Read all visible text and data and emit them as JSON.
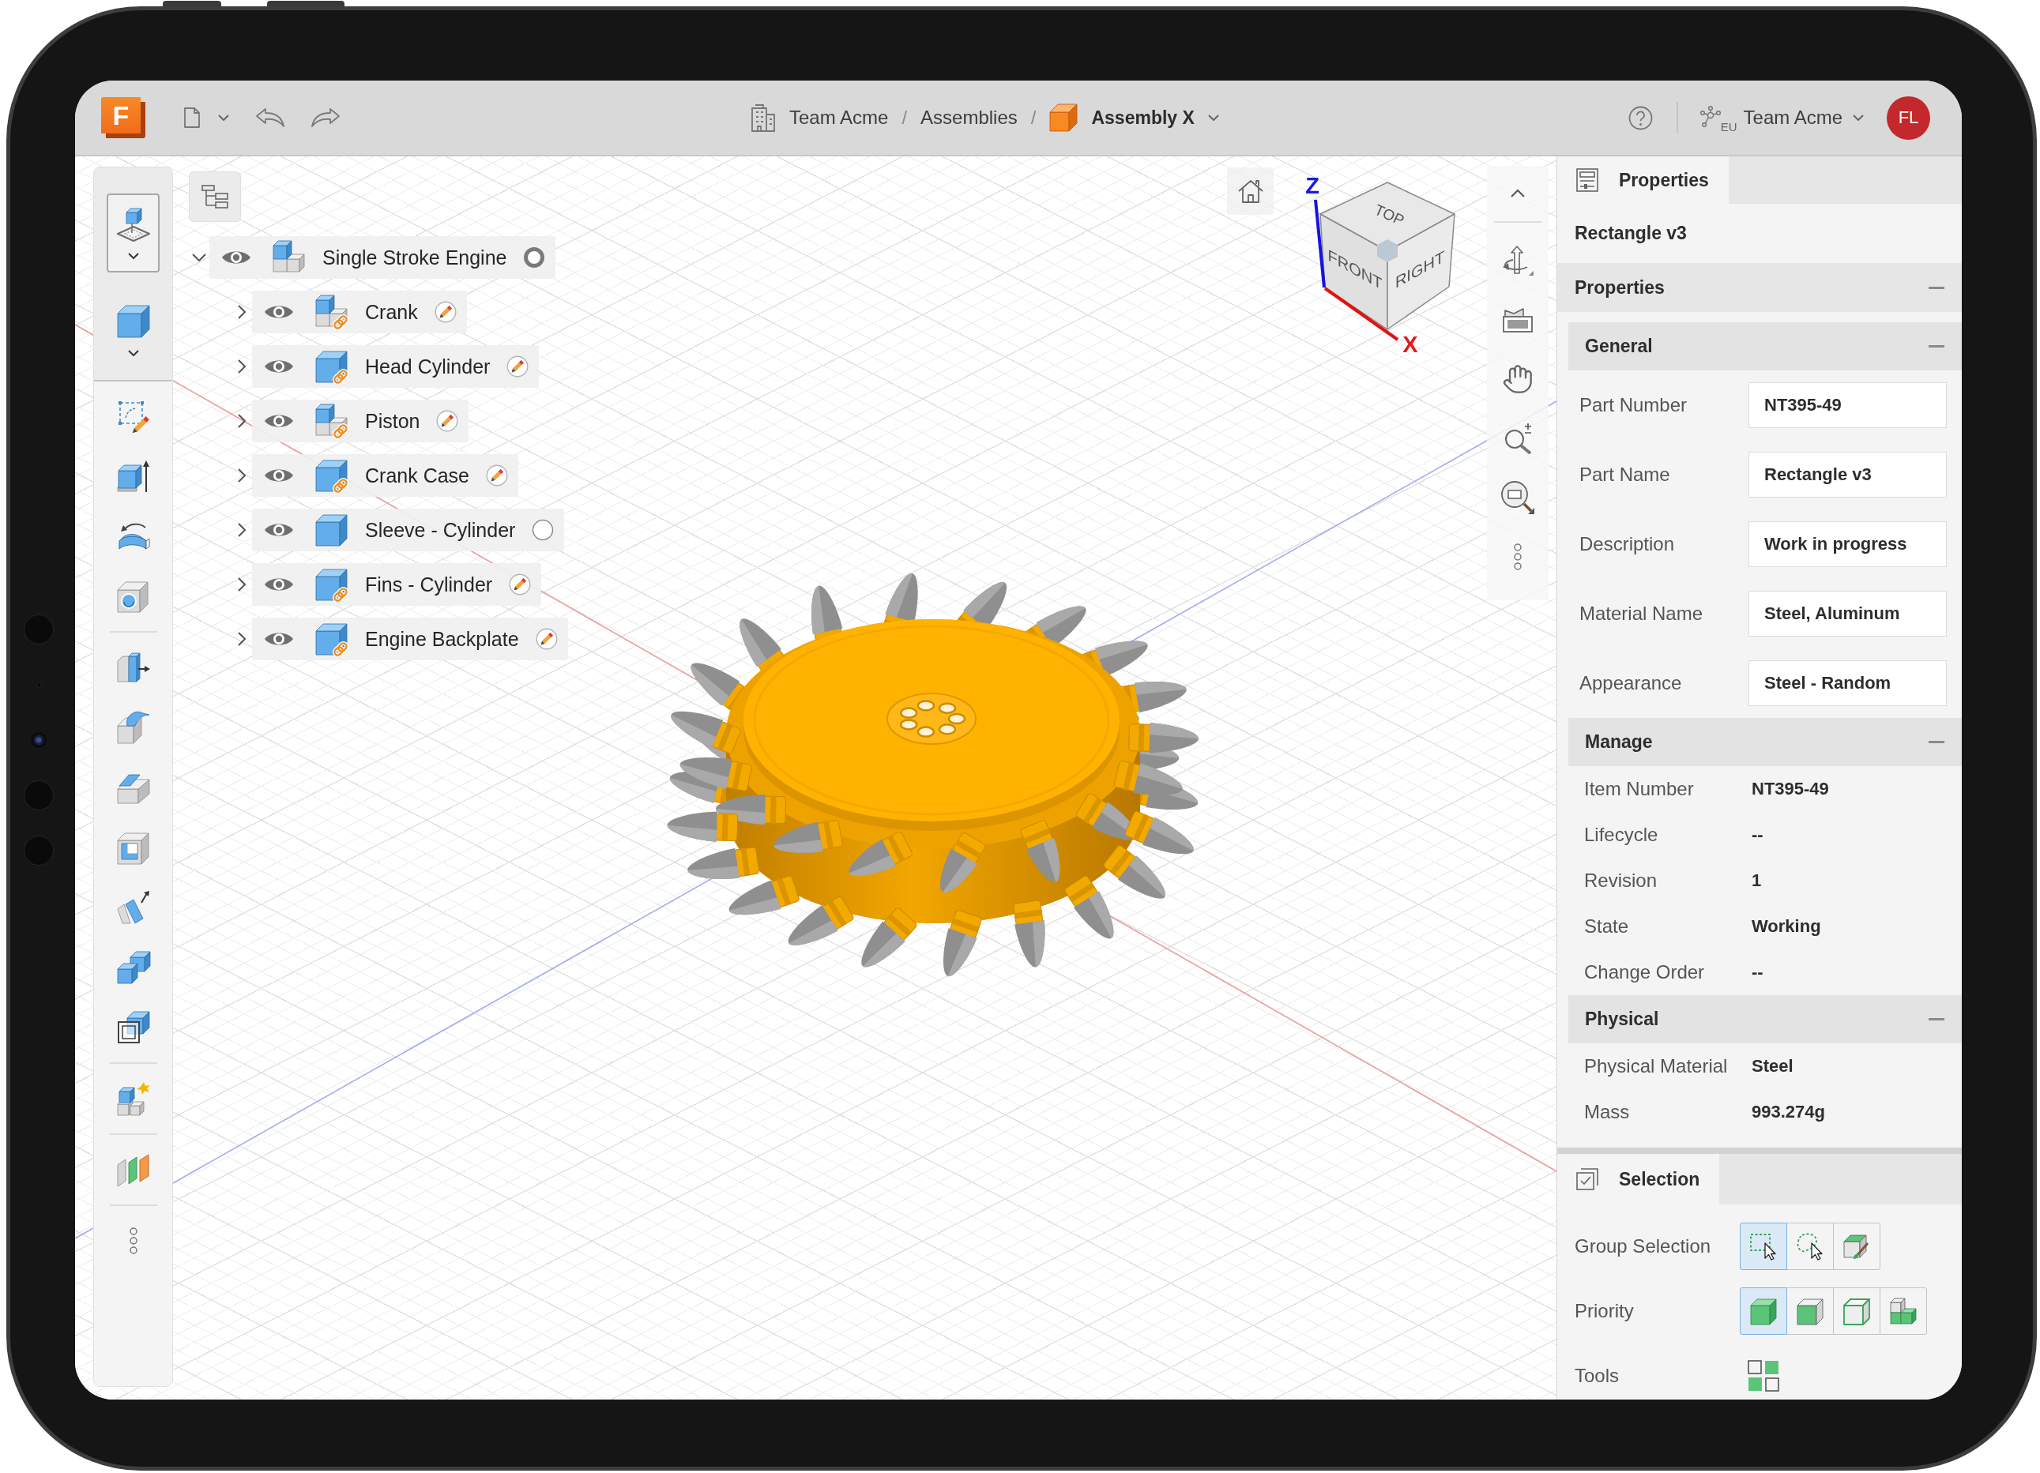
{
  "top_bar": {
    "logo": "F",
    "breadcrumb": [
      {
        "kind": "hub",
        "label": "Team Acme"
      },
      {
        "kind": "separator",
        "label": "/"
      },
      {
        "kind": "folder",
        "label": "Assemblies"
      },
      {
        "kind": "separator",
        "label": "/"
      },
      {
        "kind": "document",
        "label": "Assembly X"
      }
    ],
    "team_menu": {
      "region": "EU",
      "label": "Team Acme"
    },
    "avatar": {
      "initials": "FL"
    }
  },
  "left_toolbar": {
    "groups": [
      {
        "tools": [
          {
            "kind": "place",
            "selected": true,
            "dropdown": true
          },
          {
            "kind": "box",
            "selected": false,
            "dropdown": true
          }
        ]
      },
      {
        "tools": [
          {
            "kind": "sketch",
            "selected": false,
            "dropdown": false
          },
          {
            "kind": "extrude",
            "selected": false,
            "dropdown": false
          },
          {
            "kind": "revolve",
            "selected": false,
            "dropdown": false
          },
          {
            "kind": "hole",
            "selected": false,
            "dropdown": false
          }
        ]
      },
      {
        "tools": [
          {
            "kind": "split",
            "selected": false,
            "dropdown": false
          },
          {
            "kind": "fillet",
            "selected": false,
            "dropdown": false
          },
          {
            "kind": "chamfer",
            "selected": false,
            "dropdown": false
          },
          {
            "kind": "shell",
            "selected": false,
            "dropdown": false
          },
          {
            "kind": "draft",
            "selected": false,
            "dropdown": false
          },
          {
            "kind": "combine",
            "selected": false,
            "dropdown": false
          },
          {
            "kind": "offset",
            "selected": false,
            "dropdown": false
          }
        ]
      },
      {
        "tools": [
          {
            "kind": "component",
            "selected": false,
            "dropdown": false
          }
        ]
      },
      {
        "tools": [
          {
            "kind": "section",
            "selected": false,
            "dropdown": false
          }
        ]
      },
      {
        "tools": [
          {
            "kind": "more",
            "selected": false,
            "dropdown": false
          }
        ]
      }
    ]
  },
  "browser": {
    "root": {
      "name": "Single Stroke Engine",
      "kind": "assembly",
      "active": true,
      "linked": false,
      "visible": true,
      "expanded": true,
      "children": [
        {
          "name": "Crank",
          "kind": "assembly",
          "active": false,
          "linked": true,
          "visible": true,
          "expanded": false
        },
        {
          "name": "Head Cylinder",
          "kind": "part",
          "active": false,
          "linked": true,
          "visible": true,
          "expanded": false
        },
        {
          "name": "Piston",
          "kind": "assembly",
          "active": false,
          "linked": true,
          "visible": true,
          "expanded": false
        },
        {
          "name": "Crank Case",
          "kind": "part",
          "active": false,
          "linked": true,
          "visible": true,
          "expanded": false
        },
        {
          "name": "Sleeve - Cylinder",
          "kind": "part",
          "active": false,
          "linked": false,
          "visible": true,
          "expanded": false
        },
        {
          "name": "Fins - Cylinder",
          "kind": "part",
          "active": false,
          "linked": true,
          "visible": true,
          "expanded": false
        },
        {
          "name": "Engine Backplate",
          "kind": "part",
          "active": false,
          "linked": true,
          "visible": true,
          "expanded": false
        }
      ]
    }
  },
  "view_cube": {
    "top": "TOP",
    "front": "FRONT",
    "right": "RIGHT",
    "z_axis": "Z",
    "x_axis": "X"
  },
  "properties_panel": {
    "tab": {
      "label": "Properties",
      "selected": true
    },
    "title": "Rectangle v3",
    "section": {
      "label": "Properties",
      "expanded": true
    },
    "groups": [
      {
        "label": "General",
        "expanded": true,
        "kind": "fields",
        "rows": [
          {
            "label": "Part Number",
            "value": "NT395-49"
          },
          {
            "label": "Part Name",
            "value": "Rectangle v3"
          },
          {
            "label": "Description",
            "value": "Work in progress"
          },
          {
            "label": "Material Name",
            "value": "Steel, Aluminum"
          },
          {
            "label": "Appearance",
            "value": "Steel - Random"
          }
        ]
      },
      {
        "label": "Manage",
        "expanded": true,
        "kind": "readonly",
        "rows": [
          {
            "label": "Item Number",
            "value": "NT395-49"
          },
          {
            "label": "Lifecycle",
            "value": "--"
          },
          {
            "label": "Revision",
            "value": "1"
          },
          {
            "label": "State",
            "value": "Working"
          },
          {
            "label": "Change Order",
            "value": "--"
          }
        ]
      },
      {
        "label": "Physical",
        "expanded": true,
        "kind": "readonly",
        "rows": [
          {
            "label": "Physical Material",
            "value": "Steel"
          },
          {
            "label": "Mass",
            "value": "993.274g"
          }
        ]
      }
    ]
  },
  "selection_panel": {
    "tab": {
      "label": "Selection",
      "selected": true
    },
    "rows": [
      {
        "label": "Group Selection",
        "kind": "toggles",
        "options": [
          {
            "kind": "window",
            "selected": true
          },
          {
            "kind": "freeform",
            "selected": false
          },
          {
            "kind": "paint",
            "selected": false
          }
        ]
      },
      {
        "label": "Priority",
        "kind": "toggles",
        "options": [
          {
            "kind": "body",
            "selected": true
          },
          {
            "kind": "face",
            "selected": false
          },
          {
            "kind": "edge",
            "selected": false
          },
          {
            "kind": "component",
            "selected": false
          }
        ]
      },
      {
        "label": "Tools",
        "kind": "tool"
      }
    ]
  }
}
